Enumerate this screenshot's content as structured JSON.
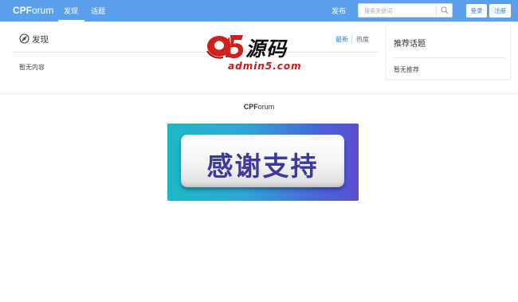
{
  "header": {
    "brand_bold": "CPF",
    "brand_light": "orum",
    "nav": [
      {
        "label": "发现",
        "active": true
      },
      {
        "label": "话题",
        "active": false
      }
    ],
    "publish_label": "发布",
    "search_placeholder": "搜索关键词",
    "login_label": "登录",
    "register_label": "注册"
  },
  "discover": {
    "title": "发现",
    "sort_latest": "最新",
    "sort_hot": "热度",
    "empty_text": "暂无内容"
  },
  "sidebar": {
    "title": "推荐话题",
    "empty_text": "暂无推荐"
  },
  "watermark": {
    "logo_mark": "a5",
    "logo_text": "源码",
    "url": "admin5.com"
  },
  "footer": {
    "brand_bold": "CPF",
    "brand_light": "orum",
    "banner_text": "感谢支持"
  },
  "colors": {
    "header_bg": "#5aa0ec",
    "link_blue": "#2d84d8",
    "logo_red": "#d11f1f"
  }
}
